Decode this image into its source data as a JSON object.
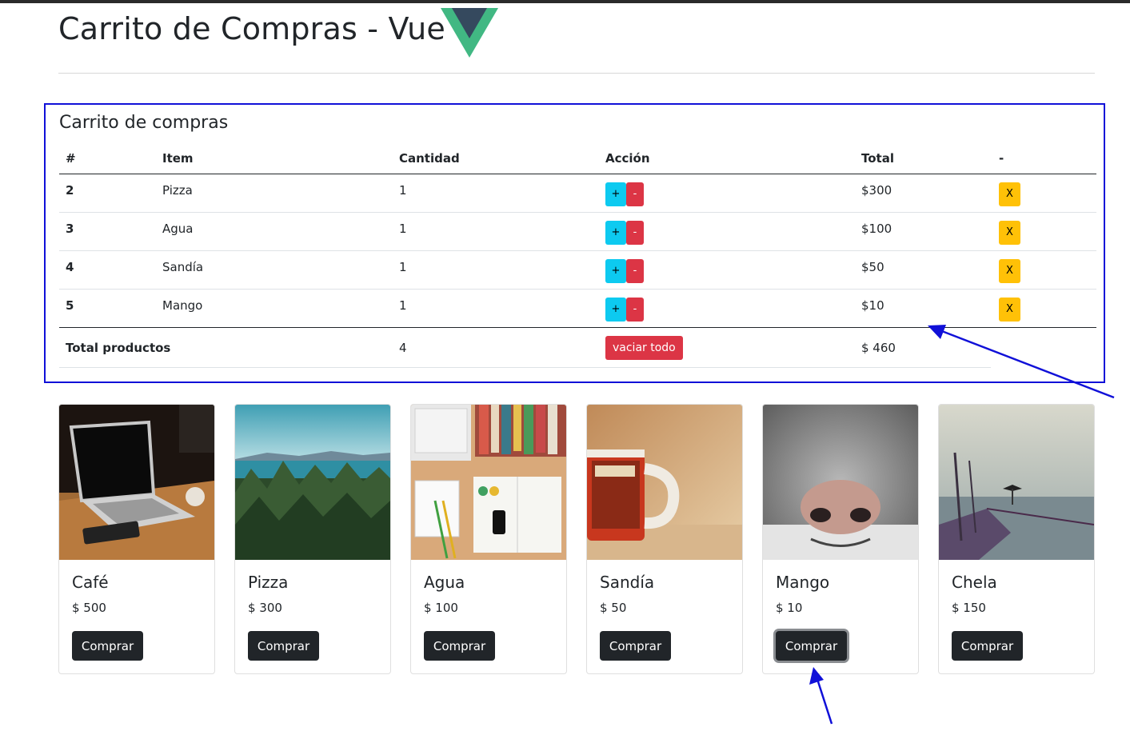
{
  "header": {
    "title": "Carrito de Compras - Vue"
  },
  "cart": {
    "title": "Carrito de compras",
    "columns": [
      "#",
      "Item",
      "Cantidad",
      "Acción",
      "Total",
      "-"
    ],
    "rows": [
      {
        "id": "2",
        "item": "Pizza",
        "qty": "1",
        "total": "$300"
      },
      {
        "id": "3",
        "item": "Agua",
        "qty": "1",
        "total": "$100"
      },
      {
        "id": "4",
        "item": "Sandía",
        "qty": "1",
        "total": "$50"
      },
      {
        "id": "5",
        "item": "Mango",
        "qty": "1",
        "total": "$10"
      }
    ],
    "plus_label": "+",
    "minus_label": "-",
    "remove_label": "X",
    "footer": {
      "label": "Total productos",
      "count": "4",
      "clear_label": "vaciar todo",
      "total": "$ 460"
    }
  },
  "products": [
    {
      "name": "Café",
      "price": "$ 500",
      "button": "Comprar"
    },
    {
      "name": "Pizza",
      "price": "$ 300",
      "button": "Comprar"
    },
    {
      "name": "Agua",
      "price": "$ 100",
      "button": "Comprar"
    },
    {
      "name": "Sandía",
      "price": "$ 50",
      "button": "Comprar"
    },
    {
      "name": "Mango",
      "price": "$ 10",
      "button": "Comprar"
    },
    {
      "name": "Chela",
      "price": "$ 150",
      "button": "Comprar"
    }
  ],
  "colors": {
    "accent_blue": "#1010d8",
    "vue_green": "#41b883",
    "vue_dark": "#35495e",
    "btn_info": "#0dcaf0",
    "btn_danger": "#dc3545",
    "btn_warning": "#ffc107",
    "btn_dark": "#212529"
  }
}
